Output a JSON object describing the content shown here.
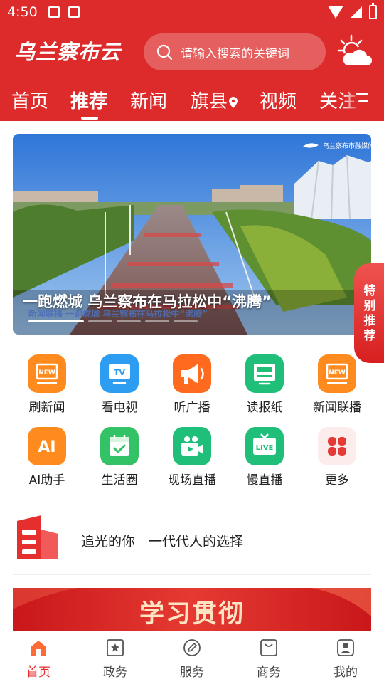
{
  "status_bar": {
    "time": "4:50"
  },
  "header": {
    "logo": "乌兰察布云",
    "search_placeholder": "请输入搜索的关键词",
    "accent_color": "#dd2a2a",
    "weather_icon": "partly-cloudy-icon"
  },
  "tabs": [
    {
      "label": "首页",
      "active": false
    },
    {
      "label": "推荐",
      "active": true
    },
    {
      "label": "新闻",
      "active": false
    },
    {
      "label": "旗县",
      "active": false
    },
    {
      "label": "视频",
      "active": false
    },
    {
      "label": "关注",
      "active": false
    }
  ],
  "banner": {
    "title": "一跑燃城  乌兰察布在马拉松中“沸腾”",
    "caption": "新闻联播  一跑燃城  乌兰察布在马拉松中“沸腾”",
    "watermark": "乌兰察布市融媒体中心"
  },
  "special_tag": [
    "特",
    "别",
    "推",
    "荐"
  ],
  "grid": [
    {
      "label": "刷新闻",
      "icon": "new-badge-icon",
      "color": "#ff8a1e"
    },
    {
      "label": "看电视",
      "icon": "tv-icon",
      "color": "#2c9df0"
    },
    {
      "label": "听广播",
      "icon": "megaphone-icon",
      "color": "#ff6a1e"
    },
    {
      "label": "读报纸",
      "icon": "newspaper-icon",
      "color": "#1fbf7a"
    },
    {
      "label": "新闻联播",
      "icon": "new-badge-icon",
      "color": "#ff8a1e"
    },
    {
      "label": "AI助手",
      "icon": "ai-icon",
      "color": "#ff8a1e"
    },
    {
      "label": "生活圈",
      "icon": "calendar-check-icon",
      "color": "#34c267"
    },
    {
      "label": "现场直播",
      "icon": "video-camera-icon",
      "color": "#1fbf7a"
    },
    {
      "label": "慢直播",
      "icon": "live-tv-icon",
      "color": "#1fbf7a"
    },
    {
      "label": "更多",
      "icon": "clover-icon",
      "color": "#e53935"
    }
  ],
  "promo": {
    "text": "追光的你｜一代代人的选择"
  },
  "red_banner": {
    "text": "学习贯彻"
  },
  "bottom_nav": [
    {
      "label": "首页",
      "icon": "home-icon",
      "active": true
    },
    {
      "label": "政务",
      "icon": "star-doc-icon",
      "active": false
    },
    {
      "label": "服务",
      "icon": "pencil-circle-icon",
      "active": false
    },
    {
      "label": "商务",
      "icon": "bag-icon",
      "active": false
    },
    {
      "label": "我的",
      "icon": "user-icon",
      "active": false
    }
  ]
}
